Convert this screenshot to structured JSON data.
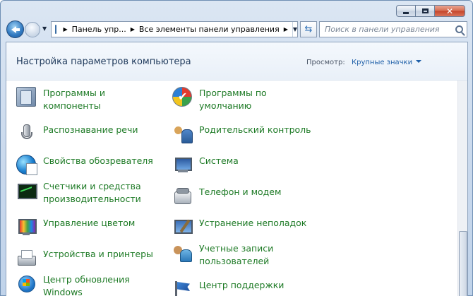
{
  "window": {
    "caption": {
      "minimize": "minimize",
      "maximize": "maximize",
      "close": "✕"
    }
  },
  "nav": {
    "breadcrumb": [
      "Панель упр...",
      "Все элементы панели управления"
    ],
    "search_placeholder": "Поиск в панели управления"
  },
  "header": {
    "title": "Настройка параметров компьютера",
    "view_label": "Просмотр:",
    "view_value": "Крупные значки"
  },
  "items": [
    {
      "label": "Программы и компоненты",
      "icon": "programs-icon"
    },
    {
      "label": "Программы по умолчанию",
      "icon": "default-programs-icon"
    },
    {
      "label": "Распознавание речи",
      "icon": "microphone-icon"
    },
    {
      "label": "Родительский контроль",
      "icon": "parental-control-icon"
    },
    {
      "label": "Свойства обозревателя",
      "icon": "internet-options-icon"
    },
    {
      "label": "Система",
      "icon": "system-icon"
    },
    {
      "label": "Счетчики и средства производительности",
      "icon": "performance-icon"
    },
    {
      "label": "Телефон и модем",
      "icon": "phone-modem-icon"
    },
    {
      "label": "Управление цветом",
      "icon": "color-management-icon"
    },
    {
      "label": "Устранение неполадок",
      "icon": "troubleshooting-icon"
    },
    {
      "label": "Устройства и принтеры",
      "icon": "printer-icon"
    },
    {
      "label": "Учетные записи пользователей",
      "icon": "user-accounts-icon"
    },
    {
      "label": "Центр обновления Windows",
      "icon": "windows-update-icon"
    },
    {
      "label": "Центр поддержки",
      "icon": "action-center-icon"
    }
  ]
}
